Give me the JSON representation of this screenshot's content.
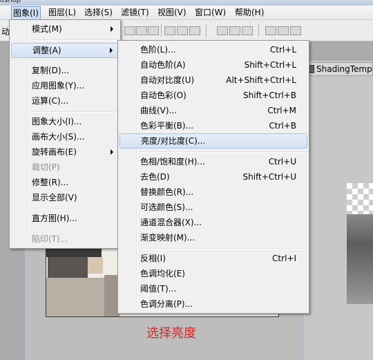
{
  "title_fragment": "oshop",
  "menubar": [
    {
      "label": "图象(I)",
      "active": true
    },
    {
      "label": "图层(L)"
    },
    {
      "label": "选择(S)"
    },
    {
      "label": "滤镜(T)"
    },
    {
      "label": "视图(V)"
    },
    {
      "label": "窗口(W)"
    },
    {
      "label": "帮助(H)"
    }
  ],
  "toolbar": {
    "label": "动"
  },
  "image_menu": [
    {
      "label": "模式(M)",
      "submenu": true
    },
    {
      "label": "调整(A)",
      "submenu": true,
      "highlighted": true
    },
    {
      "label": "复制(D)..."
    },
    {
      "label": "应用图象(Y)..."
    },
    {
      "label": "运算(C)..."
    },
    {
      "label": "图象大小(I)..."
    },
    {
      "label": "画布大小(S)..."
    },
    {
      "label": "旋转画布(E)",
      "submenu": true
    },
    {
      "label": "裁切(P)",
      "disabled": true
    },
    {
      "label": "修整(R)..."
    },
    {
      "label": "显示全部(V)"
    },
    {
      "label": "直方图(H)..."
    },
    {
      "label": "陷印(T)...",
      "disabled": true
    }
  ],
  "adjust_menu": [
    {
      "label": "色阶(L)...",
      "shortcut": "Ctrl+L"
    },
    {
      "label": "自动色阶(A)",
      "shortcut": "Shift+Ctrl+L"
    },
    {
      "label": "自动对比度(U)",
      "shortcut": "Alt+Shift+Ctrl+L"
    },
    {
      "label": "自动色彩(O)",
      "shortcut": "Shift+Ctrl+B"
    },
    {
      "label": "曲线(V)...",
      "shortcut": "Ctrl+M"
    },
    {
      "label": "色彩平衡(B)...",
      "shortcut": "Ctrl+B"
    },
    {
      "label": "亮度/对比度(C)...",
      "shortcut": "",
      "highlighted": true
    },
    {
      "label": "色相/饱和度(H)...",
      "shortcut": "Ctrl+U"
    },
    {
      "label": "去色(D)",
      "shortcut": "Shift+Ctrl+U"
    },
    {
      "label": "替换颜色(R)...",
      "shortcut": ""
    },
    {
      "label": "可选颜色(S)...",
      "shortcut": ""
    },
    {
      "label": "通道混合器(X)...",
      "shortcut": ""
    },
    {
      "label": "渐变映射(M)...",
      "shortcut": ""
    },
    {
      "label": "反相(I)",
      "shortcut": "Ctrl+I"
    },
    {
      "label": "色调均化(E)",
      "shortcut": ""
    },
    {
      "label": "阈值(T)...",
      "shortcut": ""
    },
    {
      "label": "色调分离(P)...",
      "shortcut": ""
    }
  ],
  "right_tab": {
    "label": "ShadingTempl"
  },
  "caption": "选择亮度"
}
